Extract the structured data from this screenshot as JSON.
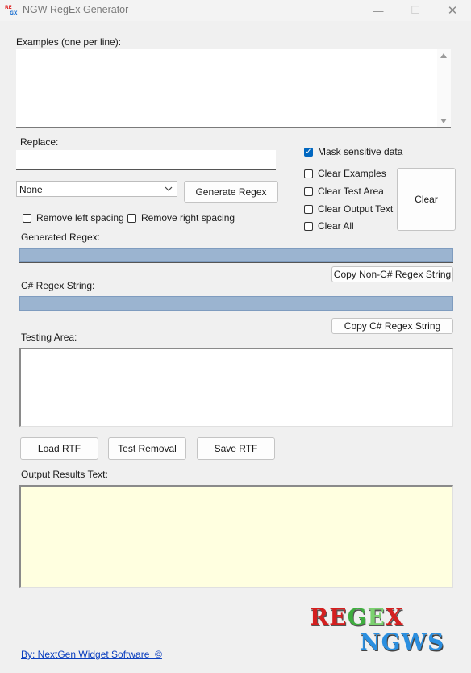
{
  "window": {
    "title": "NGW RegEx Generator",
    "minimize_glyph": "—",
    "maximize_glyph": "☐",
    "close_glyph": "✕"
  },
  "examples": {
    "label": "Examples (one per line):",
    "value": ""
  },
  "replace": {
    "label": "Replace:",
    "value": ""
  },
  "mask": {
    "label": "Mask sensitive data",
    "checked": true
  },
  "dropdown": {
    "selected": "None"
  },
  "generate_button": "Generate Regex",
  "clear_options": [
    {
      "label": "Clear Examples",
      "checked": false
    },
    {
      "label": "Clear Test Area",
      "checked": false
    },
    {
      "label": "Clear Output Text",
      "checked": false
    },
    {
      "label": "Clear All",
      "checked": false
    }
  ],
  "clear_button": "Clear",
  "remove_left": {
    "label": "Remove left spacing",
    "checked": false
  },
  "remove_right": {
    "label": "Remove right spacing",
    "checked": false
  },
  "generated_regex": {
    "label": "Generated Regex:",
    "value": ""
  },
  "copy_non_csharp_button": "Copy Non-C# Regex String",
  "csharp_regex": {
    "label": "C# Regex String:",
    "value": ""
  },
  "copy_csharp_button": "Copy C# Regex String",
  "testing_area": {
    "label": "Testing Area:",
    "value": ""
  },
  "load_rtf_button": "Load RTF",
  "test_removal_button": "Test Removal",
  "save_rtf_button": "Save RTF",
  "output_results": {
    "label": "Output Results Text:",
    "value": ""
  },
  "logo": {
    "line1": "REGEX",
    "line2": "NGWS"
  },
  "footer_link": "By: NextGen Widget Software  ©",
  "colors": {
    "output_background": "#ffffe0",
    "regex_bar": "#9bb4d0",
    "link": "#0b3fbf",
    "checkbox_checked": "#0067c0"
  }
}
